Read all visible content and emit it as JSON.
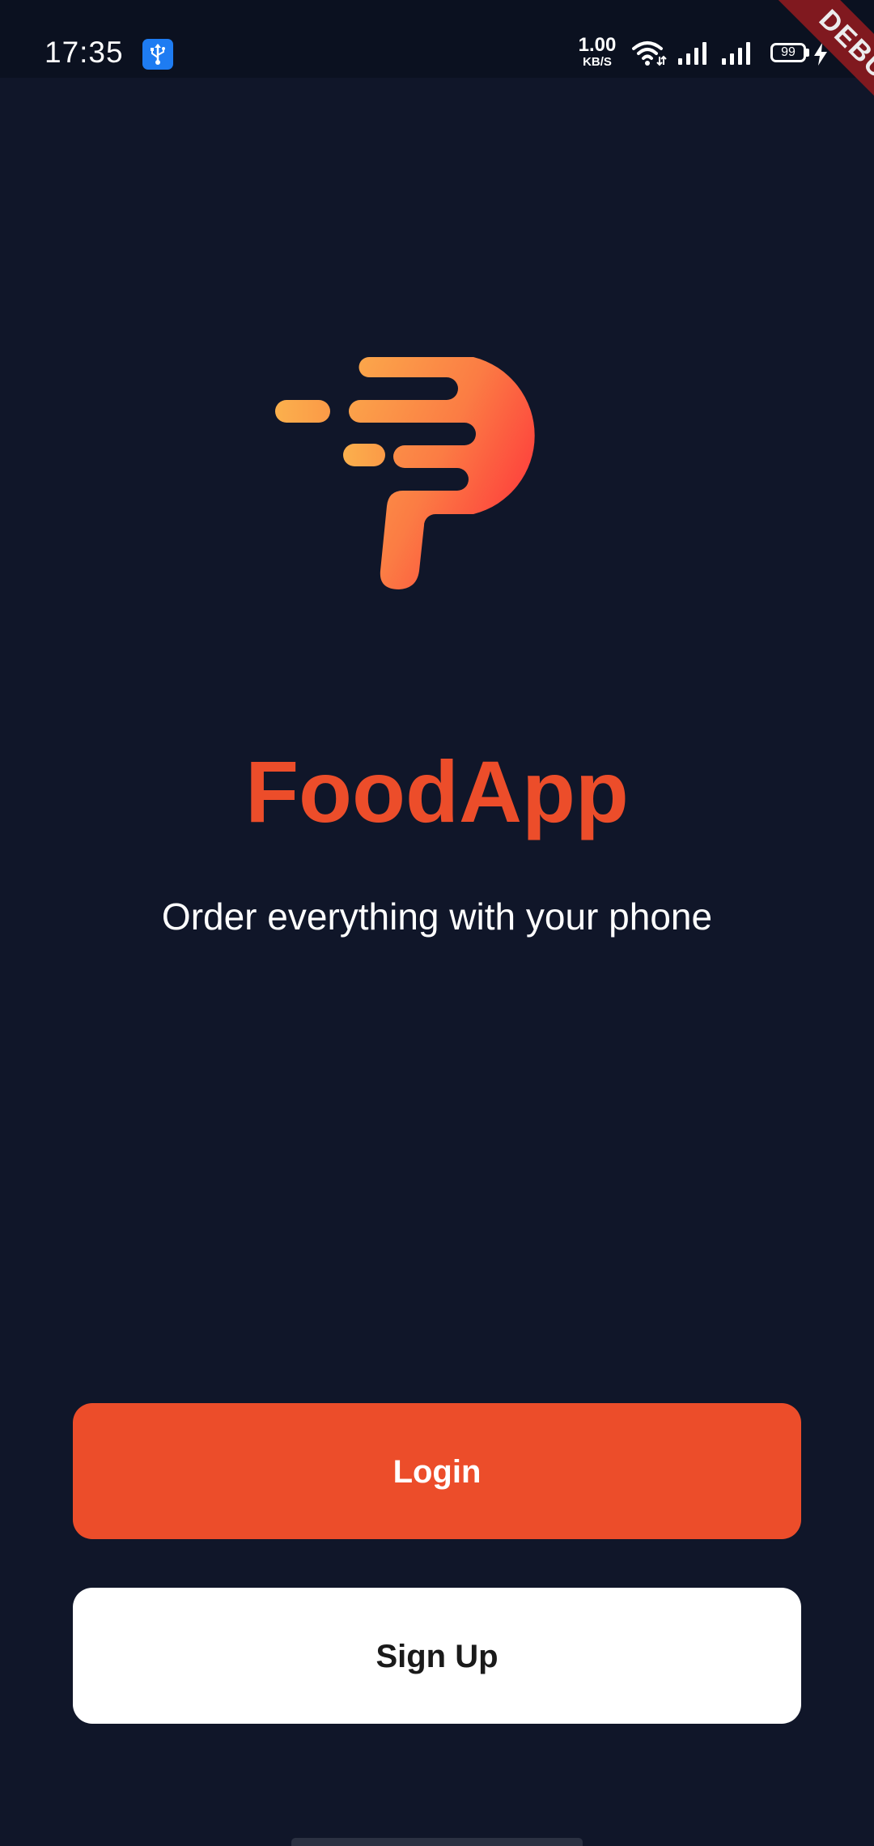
{
  "status_bar": {
    "time": "17:35",
    "net_speed_value": "1.00",
    "net_speed_unit": "KB/S",
    "battery_level": "99",
    "icons": [
      "usb-icon",
      "wifi-icon",
      "signal-icon",
      "signal-icon",
      "battery-icon",
      "charging-icon"
    ]
  },
  "debug_banner": "DEBUG",
  "app": {
    "title": "FoodApp",
    "subtitle": "Order everything with your phone"
  },
  "actions": {
    "login_label": "Login",
    "signup_label": "Sign Up"
  },
  "colors": {
    "background": "#101629",
    "accent": "#ec4d2a",
    "logo_gradient_start": "#fbaa4b",
    "logo_gradient_end": "#fe3c3c",
    "signup_bg": "#ffffff"
  }
}
